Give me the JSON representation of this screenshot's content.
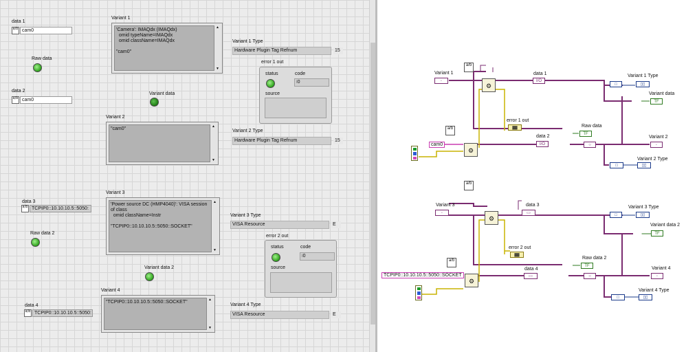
{
  "front_panel": {
    "data1": {
      "label": "data 1",
      "value": "cam0"
    },
    "data2": {
      "label": "data 2",
      "value": "cam0"
    },
    "data3": {
      "label": "data 3",
      "value": "TCPIP0::10.10.10.5::5050:"
    },
    "data4": {
      "label": "data 4",
      "value": "TCPIP0::10.10.10.5::5050:"
    },
    "raw_data": "Raw data",
    "raw_data2": "Raw data 2",
    "variant_data": "Variant data",
    "variant_data2": "Variant data 2",
    "variant1": {
      "label": "Variant 1",
      "text": "'Camera': IMAQdx (IMAQdx)\n  omid typeName=IMAQdx\n  omid className=IMAQdx\n\n\"cam0\""
    },
    "variant2": {
      "label": "Variant 2",
      "text": "\"cam0\""
    },
    "variant3": {
      "label": "Variant 3",
      "text": "'Power source DC (HMP4040)': VISA session of class\n  omid className=Instr\n\n\"TCPIP0::10.10.10.5::5050::SOCKET\""
    },
    "variant4": {
      "label": "Variant 4",
      "text": "\"TCPIP0::10.10.10.5::5050::SOCKET\""
    },
    "variant1_type": {
      "label": "Variant 1 Type",
      "value": "Hardware Plugin Tag Refnum",
      "num": "15"
    },
    "variant2_type": {
      "label": "Variant 2 Type",
      "value": "Hardware Plugin Tag Refnum",
      "num": "15"
    },
    "variant3_type": {
      "label": "Variant 3 Type",
      "value": "VISA Resource",
      "num": "E"
    },
    "variant4_type": {
      "label": "Variant 4 Type",
      "value": "VISA Resource",
      "num": "E"
    },
    "error1": {
      "label": "error 1 out",
      "status": "status",
      "code": "code",
      "code_value": "0",
      "source": "source"
    },
    "error2": {
      "label": "error 2 out",
      "status": "status",
      "code": "code",
      "code_value": "0",
      "source": "source"
    }
  },
  "block_diagram": {
    "variant1": "Variant 1",
    "variant3": "Variant 3",
    "data1": "data 1",
    "data2": "data 2",
    "data3": "data 3",
    "data4": "data 4",
    "error1_out": "error 1 out",
    "error2_out": "error 2 out",
    "raw_data": "Raw data",
    "raw_data2": "Raw data 2",
    "variant1_type": "Variant 1 Type",
    "variant2_type": "Variant 2 Type",
    "variant3_type": "Variant 3 Type",
    "variant4_type": "Variant 4 Type",
    "variant_data": "Variant data",
    "variant_data2": "Variant data 2",
    "variant2": "Variant 2",
    "variant4": "Variant 4",
    "cam0_const": "cam0",
    "tcpip_const": "TCPIP0::10.10.10.5::5050::SOCKET"
  },
  "colors": {
    "wire_variant": "#7a2b70",
    "wire_error": "#c9b400",
    "wire_string": "#c83cb0",
    "wire_bool": "#2d7a1f",
    "wire_refnum": "#1a3a8a",
    "led_on": "#2ea21c"
  }
}
